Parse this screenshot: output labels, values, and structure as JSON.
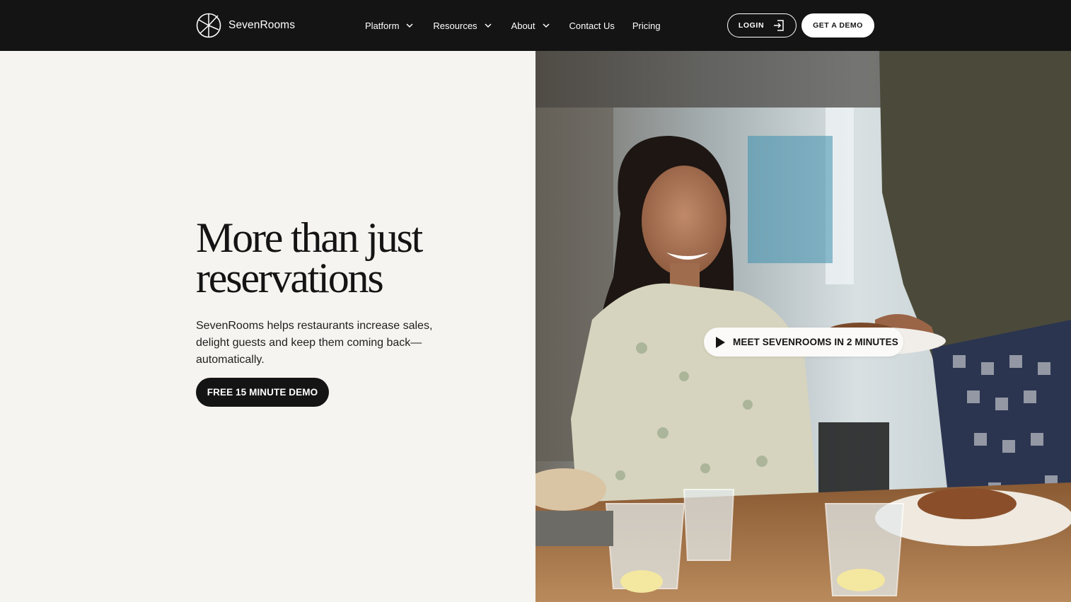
{
  "brand": {
    "name": "SevenRooms",
    "logo_icon": "sevenrooms-logo-icon"
  },
  "nav": {
    "items": [
      {
        "label": "Platform",
        "has_dropdown": true
      },
      {
        "label": "Resources",
        "has_dropdown": true
      },
      {
        "label": "About",
        "has_dropdown": true
      },
      {
        "label": "Contact Us",
        "has_dropdown": false
      },
      {
        "label": "Pricing",
        "has_dropdown": false
      }
    ],
    "login_label": "LOGIN",
    "login_icon": "login-icon",
    "demo_label": "GET A DEMO"
  },
  "hero": {
    "headline_line1": "More than just",
    "headline_line2": "reservations",
    "subtext": "SevenRooms helps restaurants increase sales, delight guests and keep them coming back—automatically.",
    "cta_label": "FREE 15 MINUTE DEMO",
    "video_label": "MEET SEVENROOMS IN 2 MINUTES",
    "video_icon": "play-icon"
  },
  "colors": {
    "header_bg": "#141414",
    "page_bg": "#f6f4f0",
    "text_dark": "#141414",
    "white": "#ffffff"
  }
}
